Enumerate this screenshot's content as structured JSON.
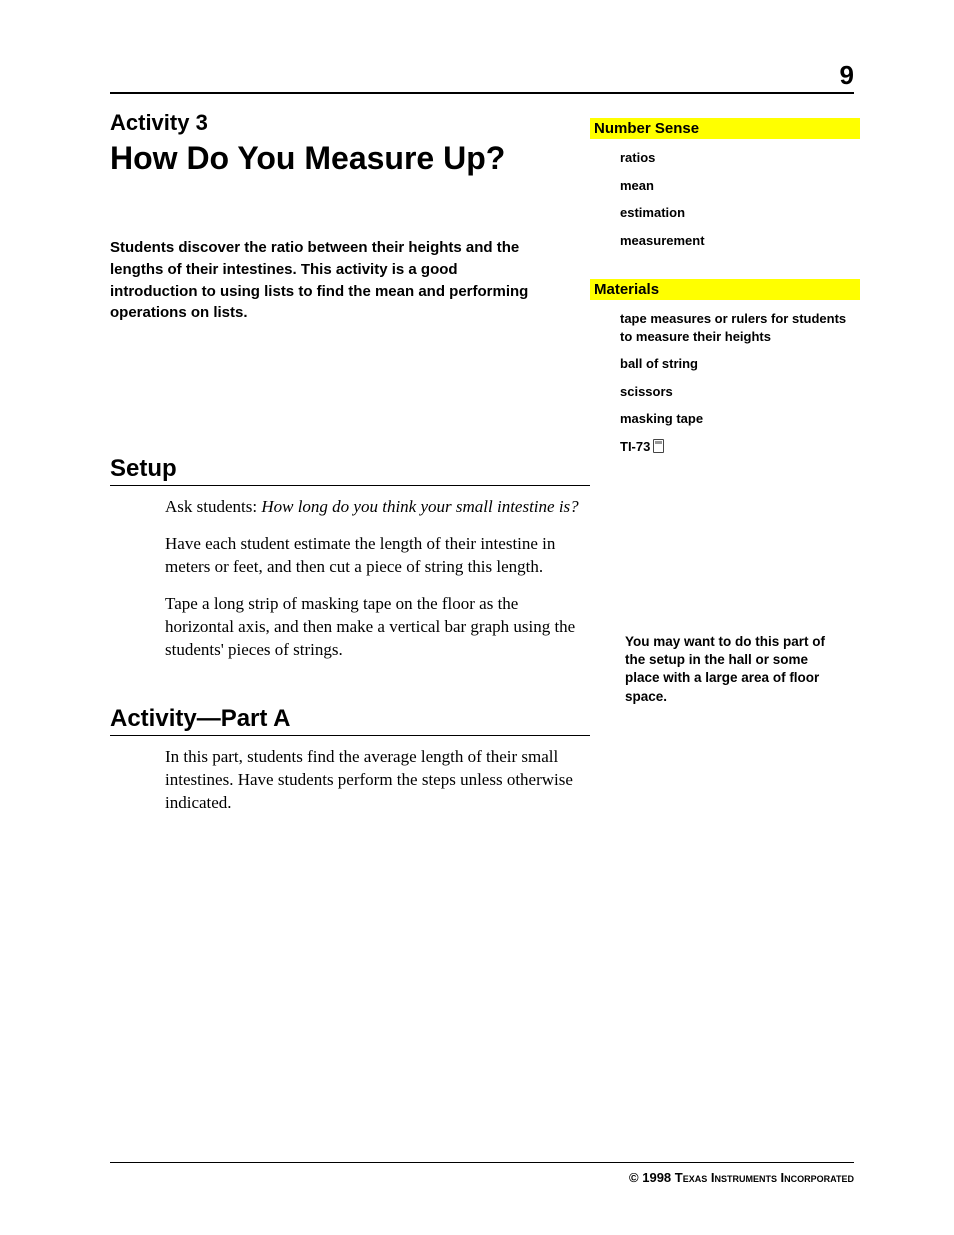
{
  "page_number": "9",
  "activity_label": "Activity 3",
  "title": "How Do You Measure Up?",
  "intro": "Students discover the ratio between their heights and the lengths of their intestines. This activity is a good introduction to using lists to find the mean and performing operations on lists.",
  "sidebar": {
    "number_sense_heading": "Number Sense",
    "number_sense_items": [
      "ratios",
      "mean",
      "estimation",
      "measurement"
    ],
    "materials_heading": "Materials",
    "materials_items": [
      "tape measures or rulers for students to measure their heights",
      "ball of string",
      "scissors",
      "masking tape",
      "TI-73"
    ]
  },
  "setup": {
    "heading": "Setup",
    "p1_lead": "Ask students:  ",
    "p1_italic": "How long do you think your small intestine is?",
    "p2": "Have each student estimate the length of their intestine in meters or feet, and then cut a piece of string this length.",
    "p3": "Tape a long strip of masking tape on the floor as the horizontal axis, and then make a vertical bar graph using the students' pieces of strings."
  },
  "part_a": {
    "heading": "Activity—Part A",
    "p1": "In this part, students find the average length of their small intestines. Have students perform the steps unless otherwise indicated."
  },
  "margin_note": "You may want to do this part of the setup in the hall or some place with a large area of floor space.",
  "footer": "© 1998 Texas Instruments Incorporated"
}
